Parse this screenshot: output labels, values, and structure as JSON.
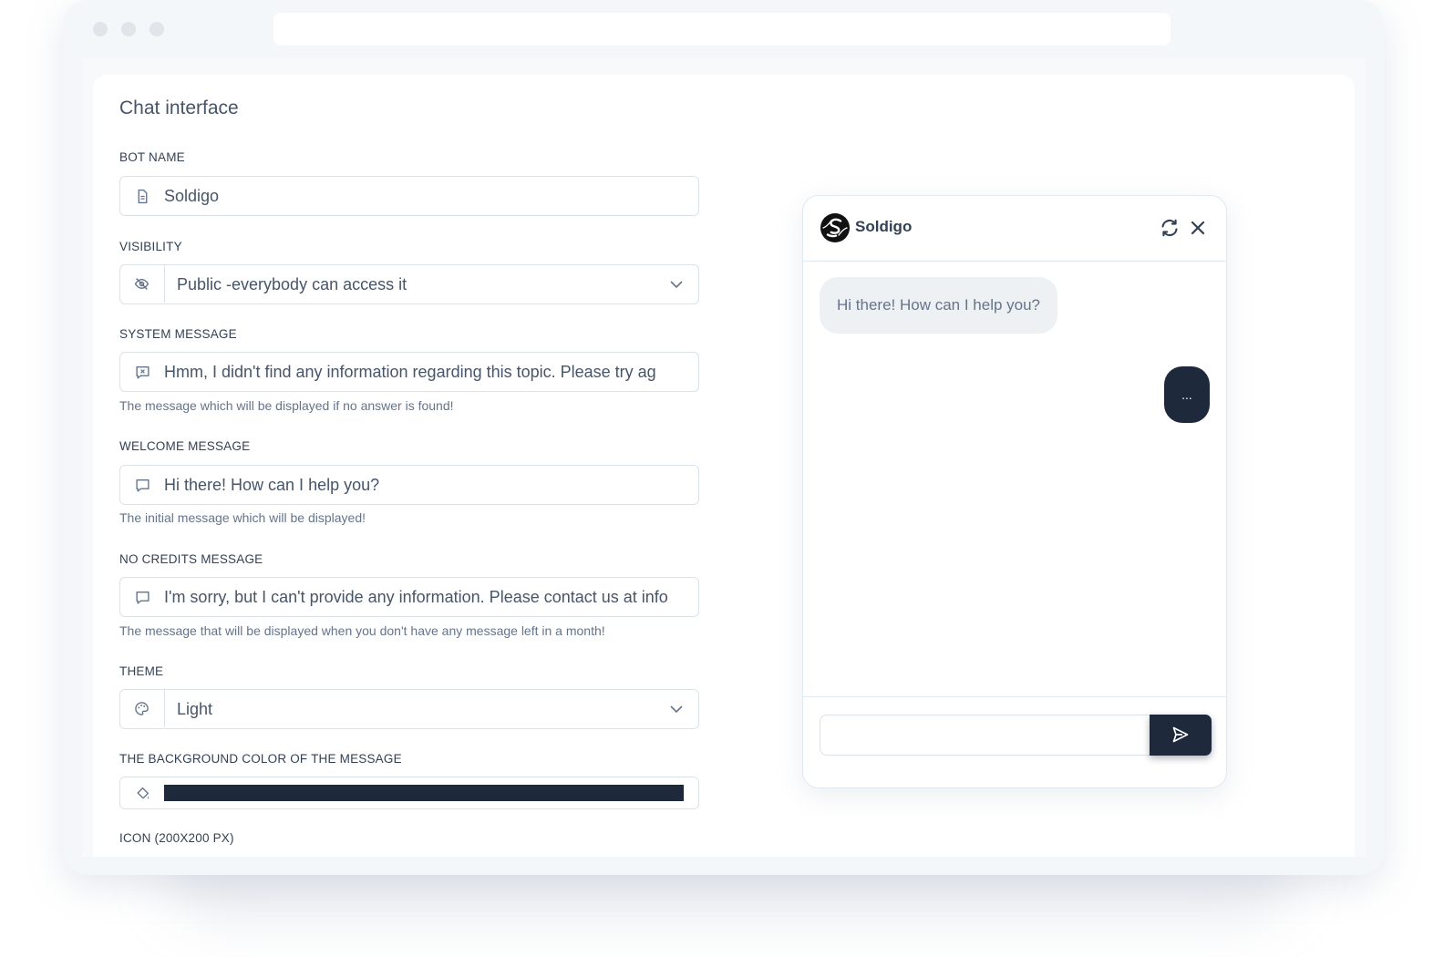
{
  "page": {
    "title": "Chat interface"
  },
  "form": {
    "bot_name": {
      "label": "BOT NAME",
      "value": "Soldigo"
    },
    "visibility": {
      "label": "VISIBILITY",
      "value": "Public -everybody can access it"
    },
    "system_message": {
      "label": "SYSTEM MESSAGE",
      "value": "Hmm, I didn't find any information regarding this topic. Please try ag",
      "help": "The message which will be displayed if no answer is found!"
    },
    "welcome_message": {
      "label": "WELCOME MESSAGE",
      "value": "Hi there! How can I help you?",
      "help": "The initial message which will be displayed!"
    },
    "no_credits_message": {
      "label": "NO CREDITS MESSAGE",
      "value": "I'm sorry, but I can't provide any information. Please contact us at info",
      "help": "The message that will be displayed when you don't have any message left in a month!"
    },
    "theme": {
      "label": "THEME",
      "value": "Light"
    },
    "background_color": {
      "label": "THE BACKGROUND COLOR OF THE MESSAGE",
      "value": "#1e293b"
    },
    "icon": {
      "label": "ICON (200X200 PX)"
    }
  },
  "chat_preview": {
    "bot_name": "Soldigo",
    "messages": [
      {
        "from": "bot",
        "text": "Hi there! How can I help you?"
      },
      {
        "from": "user",
        "text": "..."
      }
    ],
    "input_value": ""
  },
  "icons": {
    "bot_name": "document-icon",
    "visibility": "eye-slash-icon",
    "system_message": "message-x-icon",
    "welcome_message": "chat-bubble-icon",
    "no_credits_message": "chat-bubble-icon",
    "theme": "palette-icon",
    "background_color": "paint-bucket-icon",
    "chat_refresh": "refresh-icon",
    "chat_close": "close-icon",
    "chat_send": "send-icon"
  },
  "colors": {
    "accent": "#1e293b",
    "bubble_bot": "#eef1f3",
    "border": "#dbe2e8"
  }
}
